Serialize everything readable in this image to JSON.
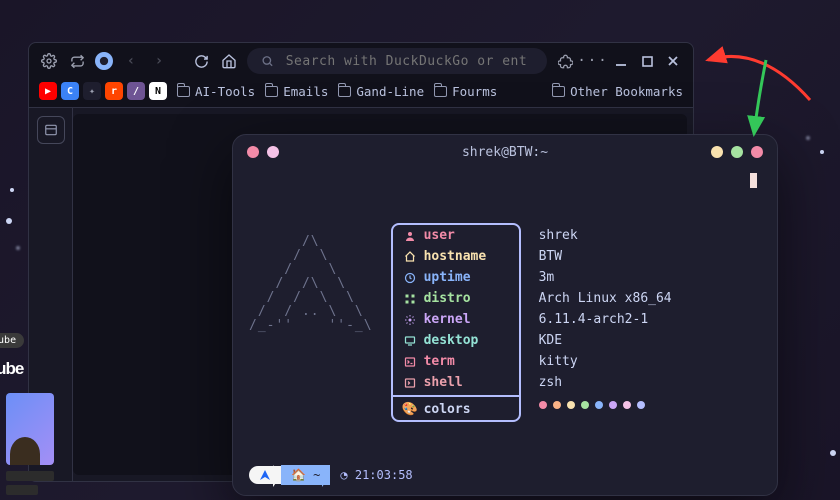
{
  "browser": {
    "search_placeholder": "Search with DuckDuckGo or ent",
    "bookmark_icons": [
      {
        "bg": "#ff0000",
        "fg": "#ffffff",
        "ch": "▶"
      },
      {
        "bg": "#3b82f6",
        "fg": "#ffffff",
        "ch": "C"
      },
      {
        "bg": "#1e1e2e",
        "fg": "#9ca0b0",
        "ch": "✦"
      },
      {
        "bg": "#ff4500",
        "fg": "#ffffff",
        "ch": "r"
      },
      {
        "bg": "#6e5494",
        "fg": "#ffffff",
        "ch": "/"
      },
      {
        "bg": "#ffffff",
        "fg": "#000000",
        "ch": "N"
      }
    ],
    "folders": [
      "AI-Tools",
      "Emails",
      "Gand-Line",
      "Fourms"
    ],
    "other_bookmarks": "Other Bookmarks"
  },
  "yt": {
    "chip": "uTube",
    "logo": "Tube"
  },
  "terminal": {
    "title": "shrek@BTW:~",
    "traffic_left": [
      "#f38ba8",
      "#f5c2e7"
    ],
    "traffic_right": [
      "#f9e2af",
      "#a6e3a1",
      "#f38ba8"
    ],
    "ascii": "      /\\\n     /  \\\n    /    \\\n   /  /\\  \\\n  /  /  \\  \\\n /  / .. \\  \\\n/_-''    ''-_\\",
    "info": [
      {
        "icon": "user",
        "color": "#f38ba8",
        "label": "user",
        "value": "shrek"
      },
      {
        "icon": "host",
        "color": "#f9e2af",
        "label": "hostname",
        "value": "BTW"
      },
      {
        "icon": "uptime",
        "color": "#89b4fa",
        "label": "uptime",
        "value": "3m"
      },
      {
        "icon": "distro",
        "color": "#a6e3a1",
        "label": "distro",
        "value": "Arch Linux x86_64"
      },
      {
        "icon": "kernel",
        "color": "#cba6f7",
        "label": "kernel",
        "value": "6.11.4-arch2-1"
      },
      {
        "icon": "desktop",
        "color": "#94e2d5",
        "label": "desktop",
        "value": "KDE"
      },
      {
        "icon": "term",
        "color": "#f38ba8",
        "label": "term",
        "value": "kitty"
      },
      {
        "icon": "shell",
        "color": "#eba0ac",
        "label": "shell",
        "value": "zsh"
      }
    ],
    "colors_label": "colors",
    "swatches": [
      "#f38ba8",
      "#fab387",
      "#f9e2af",
      "#a6e3a1",
      "#89b4fa",
      "#cba6f7",
      "#f5c2e7",
      "#b4befe"
    ],
    "prompt": {
      "icon": "⮝",
      "path": "🏠 ~",
      "time_icon": "◔",
      "time": "21:03:58"
    }
  }
}
